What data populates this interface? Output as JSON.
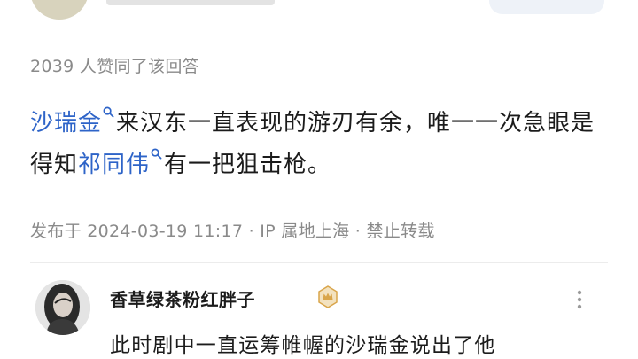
{
  "post": {
    "likes_text": "2039 人赞同了该回答",
    "answer": {
      "part1": "沙瑞金",
      "part2": "来汉东一直表现的游刃有余，唯一一次急眼是得知",
      "part3": "祁同伟",
      "part4": "有一把狙击枪。"
    },
    "meta_text": "发布于 2024-03-19 11:17 · IP 属地上海 · 禁止转载"
  },
  "comment": {
    "author": "香草绿茶粉红胖子",
    "text": "此时剧中一直运筹帷幄的沙瑞金说出了他"
  },
  "icons": {
    "keyword_search": "search-icon",
    "author_badge": "crown-badge-icon",
    "more": "more-vertical-icon"
  },
  "colors": {
    "keyword_link": "#2e64c8",
    "badge": "#d9a54a"
  }
}
